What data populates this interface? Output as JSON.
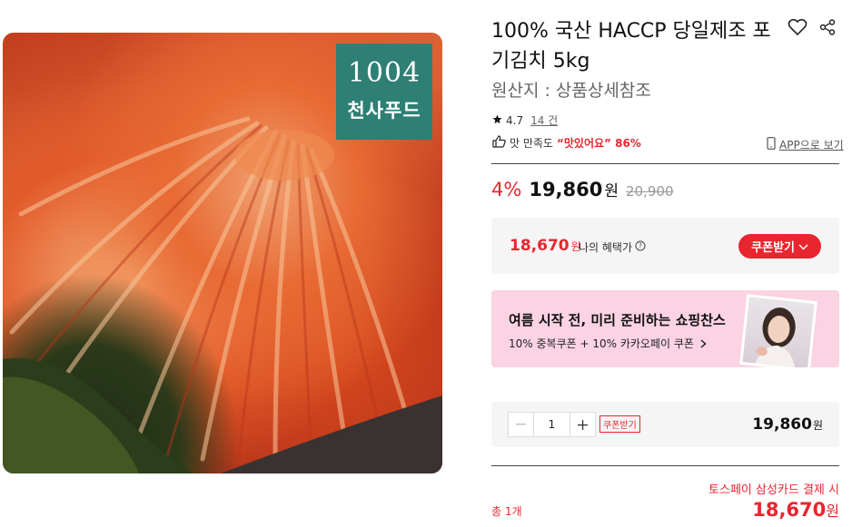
{
  "product": {
    "title": "100% 국산 HACCP 당일제조 포기김치 5kg",
    "origin": "원산지 : 상품상세참조",
    "rating": "4.7",
    "review_count": "14 건",
    "satisfaction_label": "맛 만족도",
    "satisfaction_value": "“맛있어요” 86%",
    "app_link": "APP으로 보기",
    "brand_logo": "1004",
    "brand_name": "천사푸드"
  },
  "price": {
    "discount": "4%",
    "sale": "19,860",
    "unit": "원",
    "original": "20,900"
  },
  "benefit": {
    "price": "18,670",
    "unit": "원",
    "label": "나의 혜택가",
    "coupon_button": "쿠폰받기"
  },
  "promo": {
    "title": "여름 시작 전, 미리 준비하는 쇼핑찬스",
    "subtitle": "10% 중복쿠폰 + 10% 카카오페이 쿠폰"
  },
  "order": {
    "quantity": "1",
    "coupon_tag": "쿠폰받기",
    "price": "19,860",
    "unit": "원"
  },
  "total": {
    "label": "총 1개",
    "card_note": "토스페이 삼성카드 결제 시",
    "price": "18,670",
    "unit": "원"
  },
  "icons": [
    "heart-icon",
    "share-icon",
    "star-icon",
    "thumbs-up-icon",
    "mobile-icon",
    "info-icon",
    "chevron-down-icon",
    "chevron-right-icon",
    "minus-icon",
    "plus-icon"
  ],
  "colors": {
    "accent": "#e8262f",
    "brand": "#2e7f74",
    "promo_bg": "#fbd3e3",
    "box_bg": "#f5f5f6"
  }
}
